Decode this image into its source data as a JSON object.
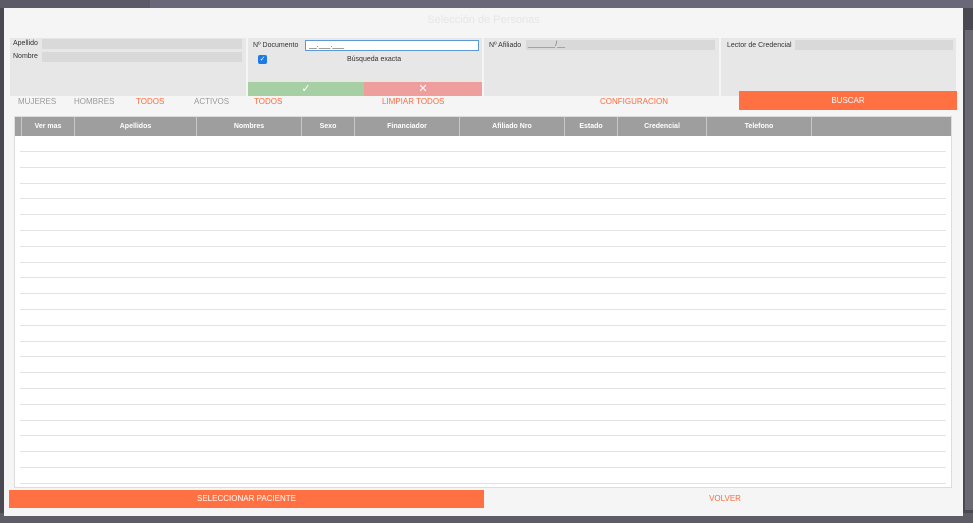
{
  "title": "Selección de Personas",
  "search": {
    "apellido_label": "Apellido",
    "nombre_label": "Nombre",
    "documento_label": "Nº Documento",
    "documento_value": "__.___.___",
    "busqueda_exacta_label": "Búsqueda exacta",
    "afiliado_label": "Nº Afiliado",
    "afiliado_value": "_______/__",
    "lector_label": "Lector de Credencial"
  },
  "icons": {
    "confirm": "✓",
    "cancel": "✕",
    "checkbox": "✓"
  },
  "filters": {
    "mujeres": "MUJERES",
    "hombres": "HOMBRES",
    "todos_sexo": "TODOS",
    "activos": "ACTIVOS",
    "todos_estado": "TODOS",
    "limpiar": "LIMPIAR TODOS",
    "configuracion": "CONFIGURACION",
    "buscar": "BUSCAR"
  },
  "table": {
    "columns": [
      "Ver mas",
      "Apellidos",
      "Nombres",
      "Sexo",
      "Financiador",
      "Afiliado Nro",
      "Estado",
      "Credencial",
      "Telefono"
    ]
  },
  "footer": {
    "seleccionar": "SELECCIONAR PACIENTE",
    "volver": "VOLVER"
  },
  "colors": {
    "accent": "#ff7043",
    "confirm": "#a6cfa4",
    "cancel": "#ef9e9e",
    "header": "#9e9e9e"
  }
}
